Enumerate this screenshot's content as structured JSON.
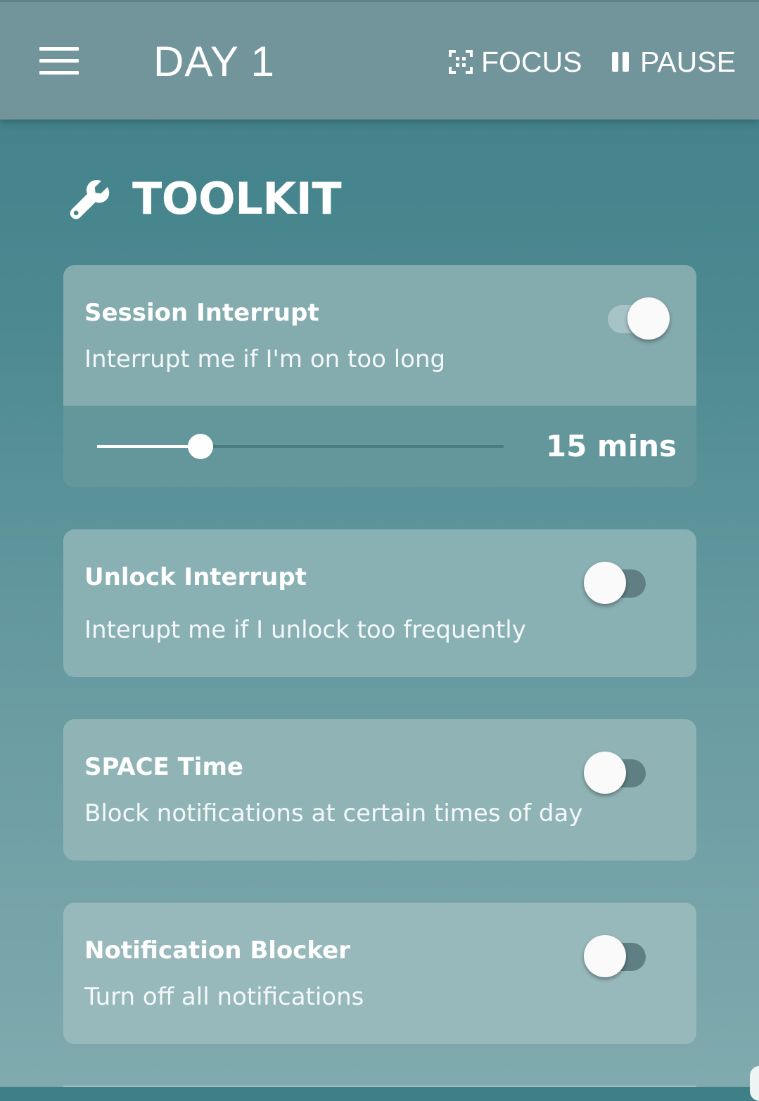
{
  "header": {
    "title": "DAY 1",
    "menu_icon": "hamburger-menu-icon",
    "focus": {
      "label": "FOCUS",
      "icon": "focus-frame-icon"
    },
    "pause": {
      "label": "PAUSE",
      "icon": "pause-icon"
    }
  },
  "section": {
    "title": "TOOLKIT",
    "icon": "wrench-icon"
  },
  "cards": [
    {
      "title": "Session Interrupt",
      "description": "Interrupt me if I'm on too long",
      "enabled": true,
      "slider": {
        "value_label": "15 mins",
        "fraction": 0.255
      }
    },
    {
      "title": "Unlock Interrupt",
      "description": "Interupt me if I unlock too frequently",
      "enabled": false
    },
    {
      "title": "SPACE Time",
      "description": "Block notifications at certain times of day",
      "enabled": false
    },
    {
      "title": "Notification Blocker",
      "description": "Turn off all notifications",
      "enabled": false
    }
  ],
  "colors": {
    "app_bar": "#72959c",
    "background_top": "#3e7f88",
    "background_bottom": "#80aaae",
    "text": "#ffffff"
  }
}
